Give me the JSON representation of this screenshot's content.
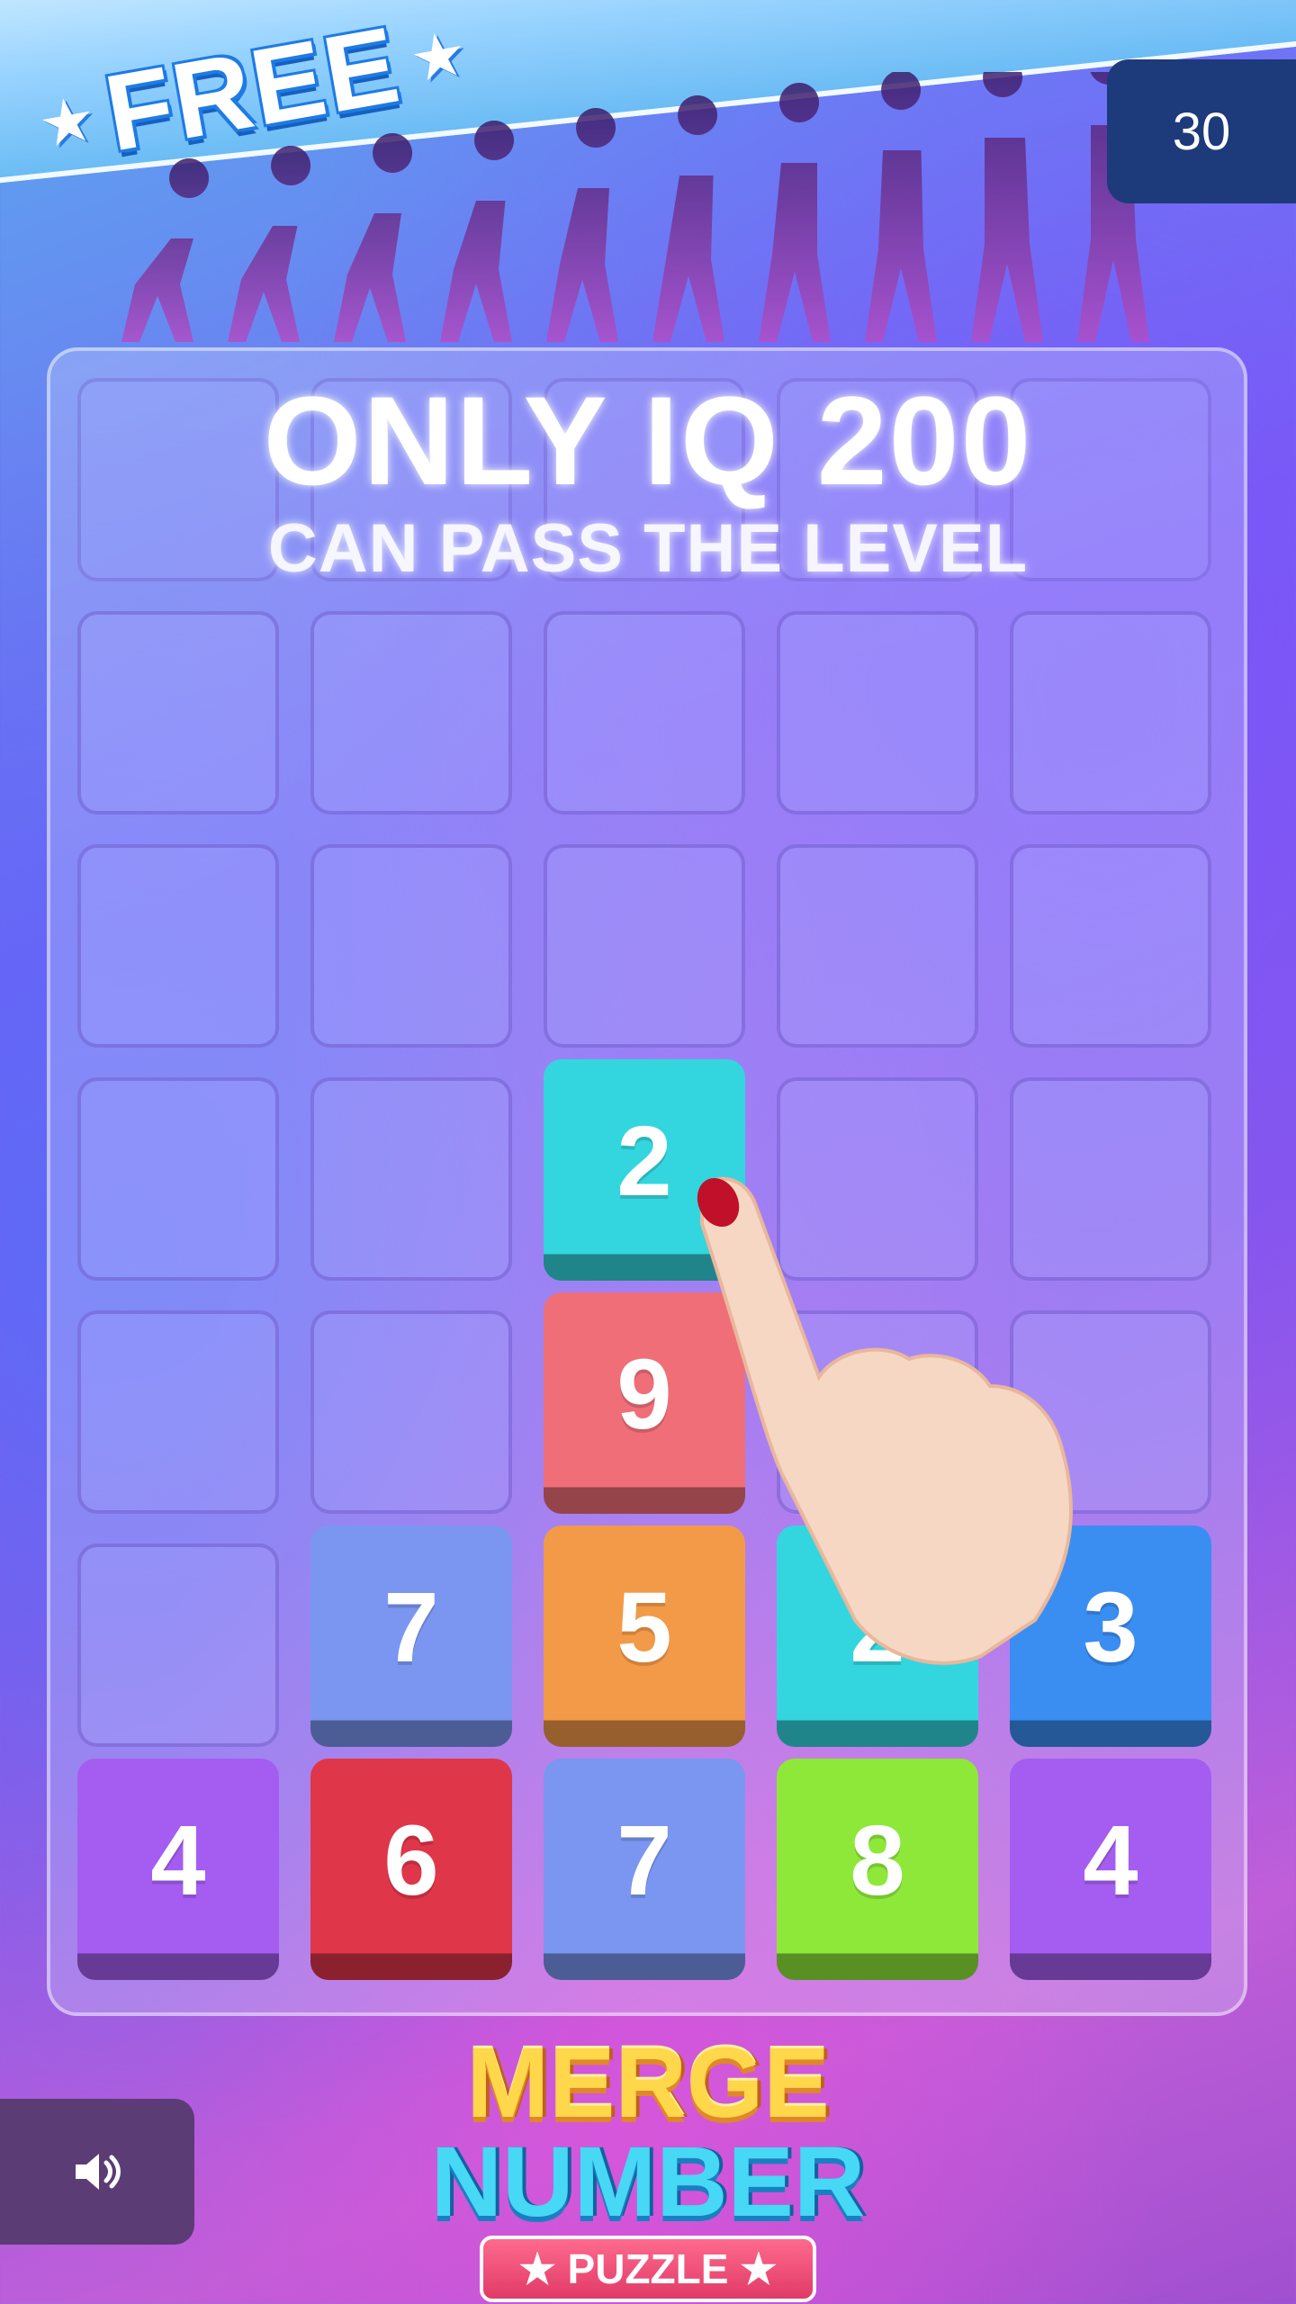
{
  "banner": {
    "label": "FREE"
  },
  "counter": {
    "value": "30"
  },
  "headline": {
    "line1": "ONLY IQ 200",
    "line2": "CAN PASS THE LEVEL"
  },
  "grid": {
    "rows": 7,
    "cols": 5,
    "tiles": [
      {
        "row": 3,
        "col": 2,
        "value": "2",
        "color": "#33d6de"
      },
      {
        "row": 4,
        "col": 2,
        "value": "9",
        "color": "#f06e78"
      },
      {
        "row": 5,
        "col": 1,
        "value": "7",
        "color": "#7b96f0"
      },
      {
        "row": 5,
        "col": 2,
        "value": "5",
        "color": "#f29a48"
      },
      {
        "row": 5,
        "col": 3,
        "value": "2",
        "color": "#33d6de"
      },
      {
        "row": 5,
        "col": 4,
        "value": "3",
        "color": "#3a8ef2"
      },
      {
        "row": 6,
        "col": 0,
        "value": "4",
        "color": "#a45df0"
      },
      {
        "row": 6,
        "col": 1,
        "value": "6",
        "color": "#e0364a"
      },
      {
        "row": 6,
        "col": 2,
        "value": "7",
        "color": "#7b96f0"
      },
      {
        "row": 6,
        "col": 3,
        "value": "8",
        "color": "#8ee83a"
      },
      {
        "row": 6,
        "col": 4,
        "value": "4",
        "color": "#a45df0"
      }
    ]
  },
  "logo": {
    "word1": "MERGE",
    "word2": "NUMBER",
    "word3": "PUZZLE"
  },
  "icons": {
    "sound": "speaker-icon",
    "hand": "pointing-hand-icon",
    "star": "star-icon"
  }
}
